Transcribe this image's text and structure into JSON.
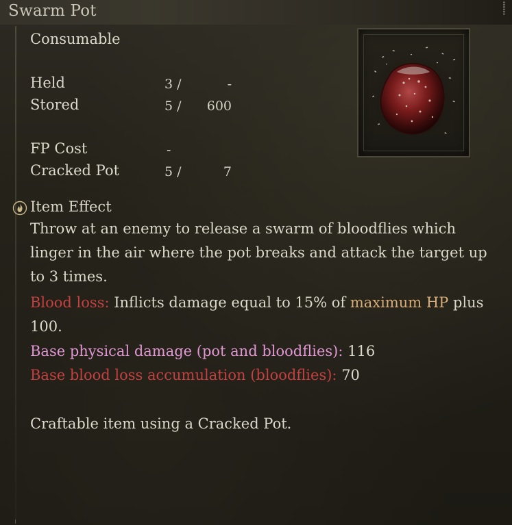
{
  "item": {
    "name": "Swarm Pot",
    "category": "Consumable"
  },
  "stats": {
    "held": {
      "label": "Held",
      "current": "3 /",
      "max": "-"
    },
    "stored": {
      "label": "Stored",
      "current": "5 /",
      "max": "600"
    },
    "fp_cost": {
      "label": "FP Cost",
      "value": "-"
    },
    "cracked_pot": {
      "label": "Cracked Pot",
      "current": "5 /",
      "max": "7"
    }
  },
  "effect": {
    "heading": "Item Effect",
    "description": "Throw at an enemy to release a swarm of bloodflies which linger in the air where the pot breaks and attack the target up to 3 times.",
    "blood_loss_label": "Blood loss:",
    "blood_loss_text_1": " Inflicts damage equal to 15% of ",
    "blood_loss_highlight": "maximum HP",
    "blood_loss_text_2": " plus 100.",
    "phys_label": "Base physical damage (pot and bloodflies):",
    "phys_value": " 116",
    "bleed_label": "Base blood loss accumulation (bloodflies):",
    "bleed_value": " 70",
    "craft_note": "Craftable item using a Cracked Pot."
  },
  "icons": {
    "effect_icon": "flame-circle-icon",
    "item_image": "swarm-pot-icon"
  },
  "colors": {
    "blood_loss": "#c64040",
    "highlight": "#d7ac76",
    "physical": "#e296d4"
  }
}
